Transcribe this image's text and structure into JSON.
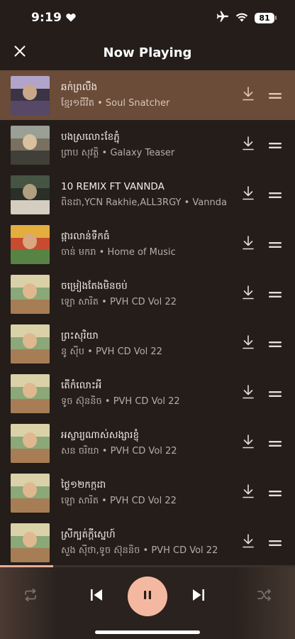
{
  "status": {
    "time": "9:19",
    "battery": "81"
  },
  "header": {
    "title": "Now Playing"
  },
  "tracks": [
    {
      "title": "ឆក់ព្រលឹង",
      "subtitle": "ខ្មែរ១ជីវិត • Soul Snatcher",
      "active": true,
      "art": {
        "bg": "#3a3444",
        "top": "#c8b8e0",
        "mid": "#5a4a6a",
        "face": "#c9a88a"
      }
    },
    {
      "title": "បងស្រលោះខែភ្ជុំ",
      "subtitle": "ព្រាប សុវត្ថិ • Galaxy Teaser",
      "active": false,
      "art": {
        "bg": "#7a7060",
        "top": "#a0a8a0",
        "mid": "#3a3a34",
        "face": "#d8c0a0"
      }
    },
    {
      "title": "10 REMIX FT VANNDA",
      "subtitle": "ពិនដា,YCN Rakhie,ALL3RGY • Vannda",
      "active": false,
      "art": {
        "bg": "#2a3028",
        "top": "#4a5a48",
        "mid": "#e8e0d0",
        "face": "#b0a080"
      }
    },
    {
      "title": "ផ្ការលាន់ទឹកធំ",
      "subtitle": "ចាន់ មករា • Home of Music",
      "active": false,
      "art": {
        "bg": "#c84a30",
        "top": "#e8c040",
        "mid": "#4a8a48",
        "face": "#d8a880"
      }
    },
    {
      "title": "ចម្រៀងតែងមិនចប់",
      "subtitle": "ឡោ សារិត • PVH CD Vol 22",
      "active": false,
      "art": {
        "bg": "#8aa878",
        "top": "#e8d8b0",
        "mid": "#a87850",
        "face": "#e0b890"
      }
    },
    {
      "title": "ព្រះសុរិយា",
      "subtitle": "នូ ស៊ីប • PVH CD Vol 22",
      "active": false,
      "art": {
        "bg": "#8aa878",
        "top": "#e8d8b0",
        "mid": "#a87850",
        "face": "#e0b890"
      }
    },
    {
      "title": "តើកំលោះអី",
      "subtitle": "ទូច ស៊ុននិច • PVH CD Vol 22",
      "active": false,
      "art": {
        "bg": "#8aa878",
        "top": "#e8d8b0",
        "mid": "#a87850",
        "face": "#e0b890"
      }
    },
    {
      "title": "អស្ចារ្យណាស់សង្សារខ្ញុំ",
      "subtitle": "សន ចរិយា • PVH CD Vol 22",
      "active": false,
      "art": {
        "bg": "#8aa878",
        "top": "#e8d8b0",
        "mid": "#a87850",
        "face": "#e0b890"
      }
    },
    {
      "title": "ថ្ងៃ១២កក្កដា",
      "subtitle": "ឡោ សារិត • PVH CD Vol 22",
      "active": false,
      "art": {
        "bg": "#8aa878",
        "top": "#e8d8b0",
        "mid": "#a87850",
        "face": "#e0b890"
      }
    },
    {
      "title": "ស្រីក្បត់ក្ដីស្នេហ៍",
      "subtitle": "សួង ស៊ីថា,ទូច ស៊ុននិច • PVH CD Vol 22",
      "active": false,
      "art": {
        "bg": "#8aa878",
        "top": "#e8d8b0",
        "mid": "#a87850",
        "face": "#e0b890"
      }
    }
  ],
  "player": {
    "progress": 0.18,
    "accent": "#f4b8a0",
    "progress_color": "#e7ae97"
  },
  "icons": {
    "close": "close-icon",
    "download": "download-icon",
    "drag": "drag-handle-icon",
    "repeat": "repeat-icon",
    "previous": "skip-previous-icon",
    "pause": "pause-icon",
    "next": "skip-next-icon",
    "shuffle": "shuffle-icon"
  }
}
